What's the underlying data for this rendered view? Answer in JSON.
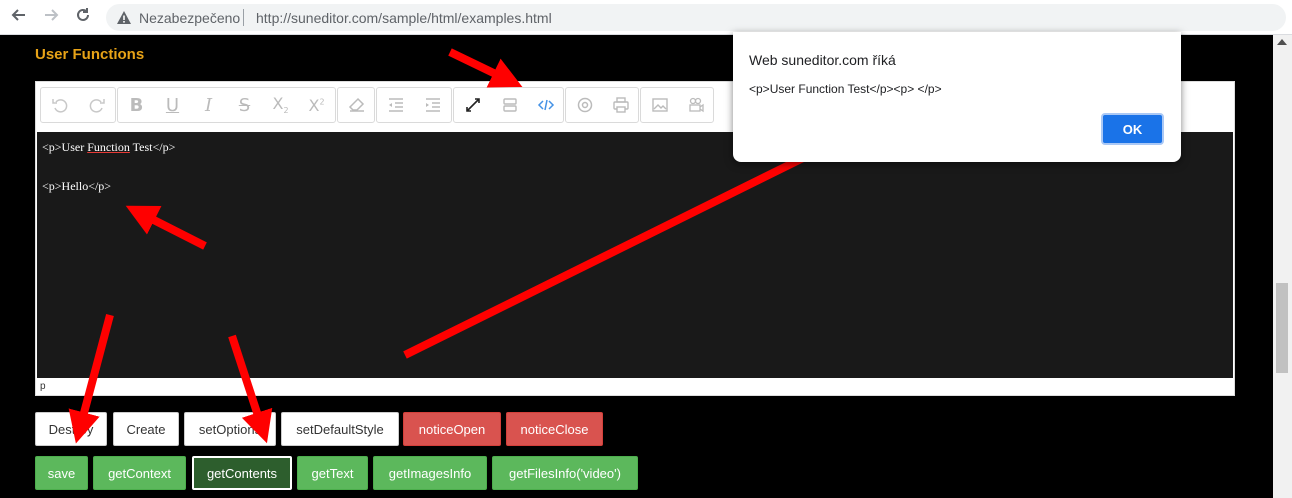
{
  "browser": {
    "security_label": "Nezabezpečeno",
    "url": "http://suneditor.com/sample/html/examples.html"
  },
  "page": {
    "section_title": "User Functions"
  },
  "editor": {
    "toolbar_groups": [
      [
        "undo-icon",
        "redo-icon"
      ],
      [
        "bold-icon",
        "underline-icon",
        "italic-icon",
        "strike-icon",
        "subscript-icon",
        "superscript-icon"
      ],
      [
        "remove-format-icon"
      ],
      [
        "outdent-icon",
        "indent-icon"
      ],
      [
        "fullscreen-icon",
        "show-blocks-icon",
        "code-view-icon"
      ],
      [
        "preview-icon",
        "print-icon"
      ],
      [
        "image-icon",
        "video-icon"
      ]
    ],
    "code_lines": [
      "<p>User Function Test</p>",
      "<p>Hello</p>"
    ],
    "code_line1_prefix": "<p>User ",
    "code_line1_underlined": "Function",
    "code_line1_suffix": " Test</p>",
    "path_label": "p"
  },
  "buttons_row1": [
    {
      "label": "Destroy",
      "style": "white"
    },
    {
      "label": "Create",
      "style": "white"
    },
    {
      "label": "setOptions",
      "style": "white"
    },
    {
      "label": "setDefaultStyle",
      "style": "white"
    },
    {
      "label": "noticeOpen",
      "style": "red"
    },
    {
      "label": "noticeClose",
      "style": "red"
    }
  ],
  "buttons_row2": [
    {
      "label": "save",
      "style": "green"
    },
    {
      "label": "getContext",
      "style": "green"
    },
    {
      "label": "getContents",
      "style": "active"
    },
    {
      "label": "getText",
      "style": "green"
    },
    {
      "label": "getImagesInfo",
      "style": "green"
    },
    {
      "label": "getFilesInfo('video')",
      "style": "green"
    }
  ],
  "dialog": {
    "title": "Web suneditor.com říká",
    "message": "<p>User Function Test</p><p> </p>",
    "ok_label": "OK"
  },
  "colors": {
    "title": "#e8a317",
    "editor_bg": "#191919",
    "red_button": "#d9534f",
    "green_button": "#5cb85c",
    "annotation_arrow": "#ff0000",
    "ok_button": "#1a73e8"
  }
}
